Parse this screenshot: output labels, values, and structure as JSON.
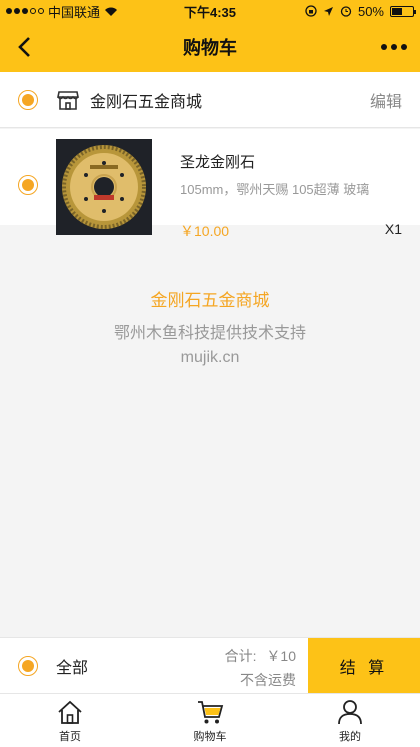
{
  "status_bar": {
    "carrier": "中国联通",
    "time": "下午4:35",
    "battery": "50%",
    "battery_level": 0.5
  },
  "nav": {
    "title": "购物车"
  },
  "shop": {
    "name": "金刚石五金商城",
    "edit_label": "编辑"
  },
  "cart_items": [
    {
      "name": "圣龙金刚石",
      "description": "105mm，鄂州天赐 105超薄 玻璃",
      "price": "￥10.00",
      "quantity": "X1"
    }
  ],
  "footer_info": {
    "shop_name": "金刚石五金商城",
    "support": "鄂州木鱼科技提供技术支持",
    "site": "mujik.cn"
  },
  "checkout": {
    "all_label": "全部",
    "total_label": "合计:",
    "total_value": "￥10",
    "shipping": "不含运费",
    "button": "结 算"
  },
  "tabs": [
    {
      "label": "首页",
      "icon": "home-icon"
    },
    {
      "label": "购物车",
      "icon": "cart-icon"
    },
    {
      "label": "我的",
      "icon": "profile-icon"
    }
  ],
  "colors": {
    "primary": "#fdc217",
    "accent": "#f5a623"
  }
}
